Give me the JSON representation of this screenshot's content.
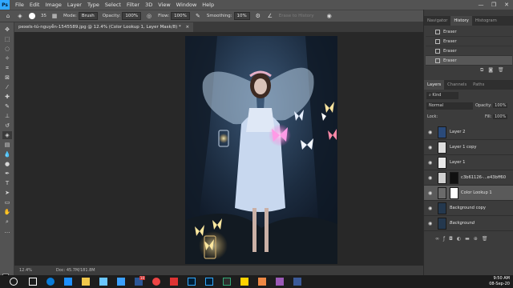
{
  "menu": {
    "logo": "Ps",
    "items": [
      "File",
      "Edit",
      "Image",
      "Layer",
      "Type",
      "Select",
      "Filter",
      "3D",
      "View",
      "Window",
      "Help"
    ],
    "controls": [
      "—",
      "❐",
      "✕"
    ]
  },
  "options": {
    "brush_size": "35",
    "mode_label": "Mode:",
    "mode_value": "Brush",
    "opacity_label": "Opacity:",
    "opacity_value": "100%",
    "flow_label": "Flow:",
    "flow_value": "100%",
    "smoothing_label": "Smoothing:",
    "smoothing_value": "10%",
    "erase_history_label": "Erase to History"
  },
  "document": {
    "tab_title": "pexels-tú-nguyễn-1545589.jpg @ 12.4% (Color Lookup 1, Layer Mask/8) *",
    "close": "×"
  },
  "status": {
    "zoom": "12.4%",
    "doc_info": "Doc: 45.7M/181.8M"
  },
  "history_panel": {
    "tabs": [
      "Navigator",
      "History",
      "Histogram"
    ],
    "items": [
      "Eraser",
      "Eraser",
      "Eraser",
      "Eraser"
    ]
  },
  "layers_panel": {
    "tabs": [
      "Layers",
      "Channels",
      "Paths"
    ],
    "kind_label": "Kind",
    "blend_mode": "Normal",
    "opacity_label": "Opacity:",
    "opacity_value": "100%",
    "lock_label": "Lock:",
    "fill_label": "Fill:",
    "fill_value": "100%",
    "layers": [
      {
        "name": "Layer 2"
      },
      {
        "name": "Layer 1 copy"
      },
      {
        "name": "Layer 1"
      },
      {
        "name": "c3b61126-...e43bff60"
      },
      {
        "name": "Color Lookup 1"
      },
      {
        "name": "Background copy"
      },
      {
        "name": "Background"
      }
    ]
  },
  "taskbar": {
    "time": "9:50 AM",
    "date": "08-Sep-20",
    "badge": "10"
  },
  "colors": {
    "accent": "#31a8ff",
    "panel": "#3c3c3c",
    "bar": "#535353"
  }
}
